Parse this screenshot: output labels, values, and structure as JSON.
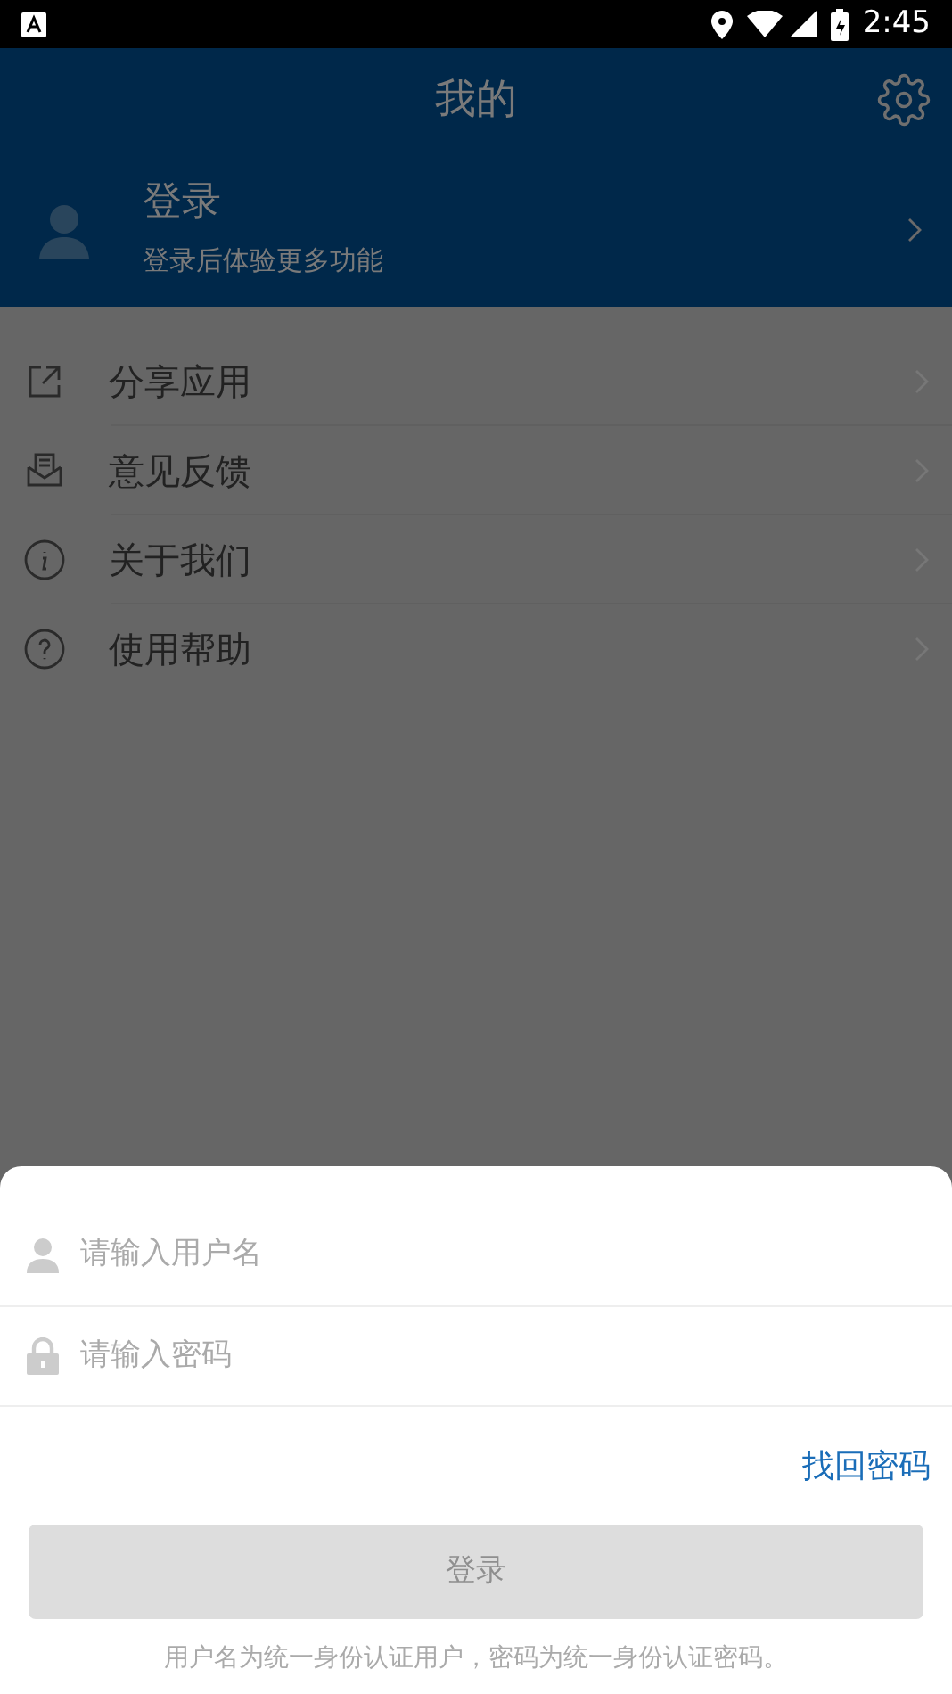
{
  "status_bar": {
    "time": "2:45"
  },
  "header": {
    "title": "我的"
  },
  "profile": {
    "name": "登录",
    "subtitle": "登录后体验更多功能"
  },
  "menu": [
    {
      "label": "分享应用"
    },
    {
      "label": "意见反馈"
    },
    {
      "label": "关于我们"
    },
    {
      "label": "使用帮助"
    }
  ],
  "login_sheet": {
    "username": {
      "placeholder": "请输入用户名"
    },
    "password": {
      "placeholder": "请输入密码"
    },
    "forgot_link": "找回密码",
    "login_button": {
      "label": "登录",
      "disabled": true
    },
    "note": "用户名为统一身份认证用户，密码为统一身份认证密码。"
  }
}
